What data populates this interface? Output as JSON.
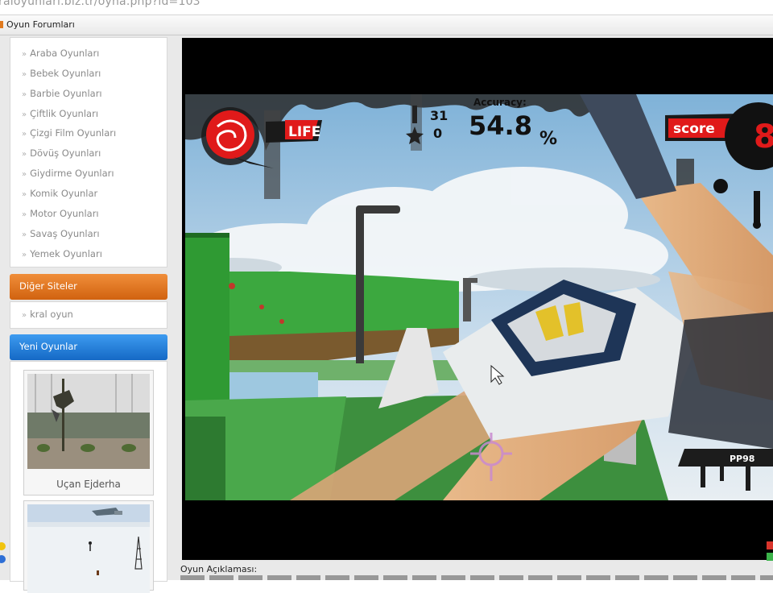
{
  "browser": {
    "url_text": "raloyunlari.biz.tr/oyna.php?id=103",
    "favorites_item": "Oyun Forumları"
  },
  "sidebar": {
    "categories": [
      "Araba Oyunları",
      "Bebek Oyunları",
      "Barbie Oyunları",
      "Çiftlik Oyunları",
      "Çizgi Film Oyunları",
      "Dövüş Oyunları",
      "Giydirme Oyunları",
      "Komik Oyunlar",
      "Motor Oyunları",
      "Savaş Oyunları",
      "Yemek Oyunları"
    ],
    "other_sites_title": "Diğer Siteler",
    "other_sites": [
      "kral oyun"
    ],
    "new_games_title": "Yeni Oyunlar",
    "new_games": [
      {
        "caption": "Uçan Ejderha"
      },
      {
        "caption": ""
      }
    ]
  },
  "game": {
    "hud": {
      "life_label": "LIFE",
      "ammo": "31",
      "kills": "0",
      "accuracy_label": "Accuracy:",
      "accuracy_value": "54.8",
      "accuracy_unit": "%",
      "score_label": "score",
      "score_value": "8",
      "weapon_label": "PP98"
    }
  },
  "description": {
    "label": "Oyun Açıklaması:"
  },
  "colors": {
    "orange_header": "#e07a22",
    "blue_header": "#2b84dd",
    "hud_red": "#e01010"
  }
}
